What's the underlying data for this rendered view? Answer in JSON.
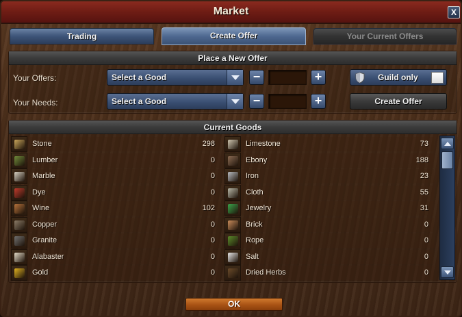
{
  "window": {
    "title": "Market",
    "close_label": "X"
  },
  "tabs": [
    {
      "label": "Trading",
      "state": "normal"
    },
    {
      "label": "Create Offer",
      "state": "active"
    },
    {
      "label": "Your Current Offers",
      "state": "disabled"
    }
  ],
  "new_offer": {
    "header": "Place a New Offer",
    "offers_label": "Your Offers:",
    "needs_label": "Your Needs:",
    "offers_select": "Select a Good",
    "needs_select": "Select a Good",
    "minus_label": "−",
    "plus_label": "+",
    "guild_only_label": "Guild only",
    "guild_only_checked": false,
    "create_offer_button": "Create Offer"
  },
  "current_goods": {
    "header": "Current Goods",
    "left_column": [
      {
        "name": "Stone",
        "value": "298",
        "icon": "stone-icon",
        "color": "#c9a55a"
      },
      {
        "name": "Lumber",
        "value": "0",
        "icon": "lumber-icon",
        "color": "#6f8a3a"
      },
      {
        "name": "Marble",
        "value": "0",
        "icon": "marble-icon",
        "color": "#d8d2c4"
      },
      {
        "name": "Dye",
        "value": "0",
        "icon": "dye-icon",
        "color": "#c0392b"
      },
      {
        "name": "Wine",
        "value": "102",
        "icon": "wine-icon",
        "color": "#b5713a"
      },
      {
        "name": "Copper",
        "value": "0",
        "icon": "copper-icon",
        "color": "#8a7a66"
      },
      {
        "name": "Granite",
        "value": "0",
        "icon": "granite-icon",
        "color": "#6f6f6f"
      },
      {
        "name": "Alabaster",
        "value": "0",
        "icon": "alabaster-icon",
        "color": "#e4dcc8"
      },
      {
        "name": "Gold",
        "value": "0",
        "icon": "gold-icon",
        "color": "#e0b120"
      }
    ],
    "right_column": [
      {
        "name": "Limestone",
        "value": "73",
        "icon": "limestone-icon",
        "color": "#cfc6b0"
      },
      {
        "name": "Ebony",
        "value": "188",
        "icon": "ebony-icon",
        "color": "#8a6a52"
      },
      {
        "name": "Iron",
        "value": "23",
        "icon": "iron-icon",
        "color": "#b8bcc2"
      },
      {
        "name": "Cloth",
        "value": "55",
        "icon": "cloth-icon",
        "color": "#b8b8a8"
      },
      {
        "name": "Jewelry",
        "value": "31",
        "icon": "jewelry-icon",
        "color": "#3aa34a"
      },
      {
        "name": "Brick",
        "value": "0",
        "icon": "brick-icon",
        "color": "#c98b5a"
      },
      {
        "name": "Rope",
        "value": "0",
        "icon": "rope-icon",
        "color": "#5a8a2a"
      },
      {
        "name": "Salt",
        "value": "0",
        "icon": "salt-icon",
        "color": "#e8e8e8"
      },
      {
        "name": "Dried Herbs",
        "value": "0",
        "icon": "dried-herbs-icon",
        "color": "#6a4a2a"
      }
    ]
  },
  "footer": {
    "ok_label": "OK"
  }
}
